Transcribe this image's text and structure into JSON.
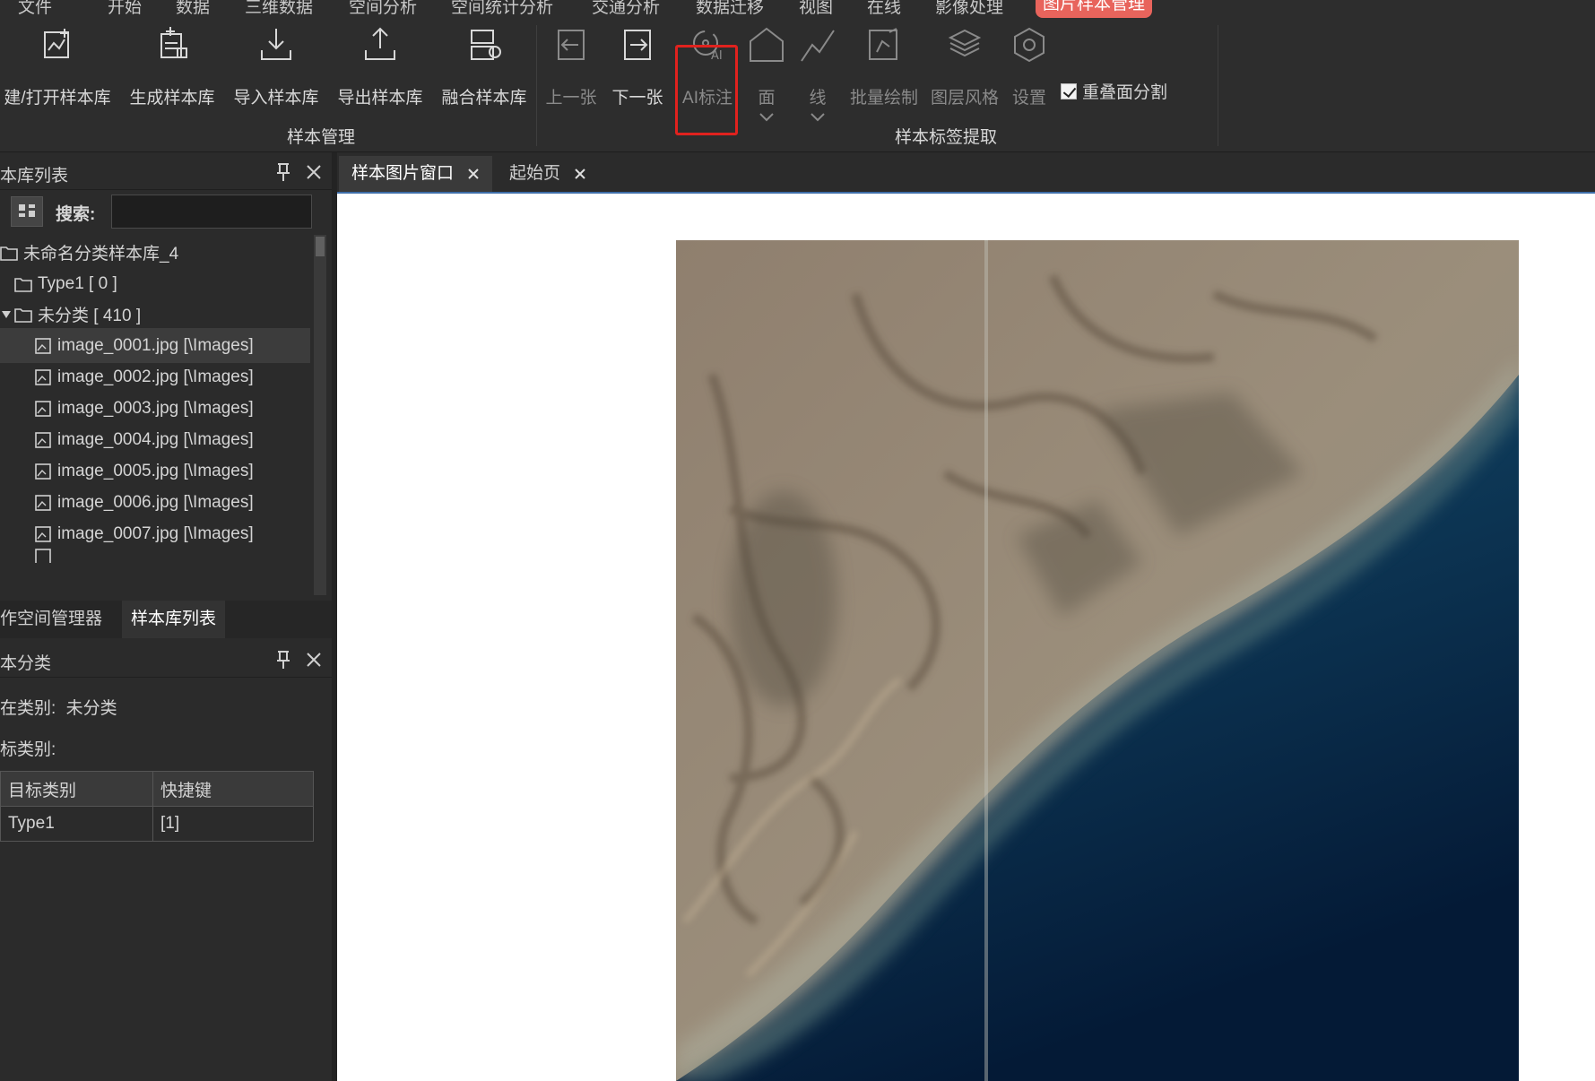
{
  "menu": {
    "items": [
      "文件",
      "开始",
      "数据",
      "三维数据",
      "空间分析",
      "空间统计分析",
      "交通分析",
      "数据迁移",
      "视图",
      "在线",
      "影像处理"
    ],
    "active": "图片样本管理"
  },
  "ribbon": {
    "sample_management": {
      "group_label": "样本管理",
      "buttons": [
        "建/打开样本库",
        "生成样本库",
        "导入样本库",
        "导出样本库",
        "融合样本库"
      ]
    },
    "label_extraction": {
      "group_label": "样本标签提取",
      "prev": "上一张",
      "next": "下一张",
      "ai_label": "AI标注",
      "polygon": "面",
      "line": "线",
      "batch_draw": "批量绘制",
      "layer_style": "图层风格",
      "settings": "设置",
      "overlap_split": "重叠面分割",
      "overlap_checked": true
    }
  },
  "library_panel": {
    "title": "本库列表",
    "search_label": "搜索:",
    "search_value": "",
    "root": "未命名分类样本库_4",
    "type1": "Type1 [ 0 ]",
    "unclassified": "未分类 [ 410 ]",
    "files": [
      "image_0001.jpg [\\Images]",
      "image_0002.jpg [\\Images]",
      "image_0003.jpg [\\Images]",
      "image_0004.jpg [\\Images]",
      "image_0005.jpg [\\Images]",
      "image_0006.jpg [\\Images]",
      "image_0007.jpg [\\Images]"
    ]
  },
  "bottom_tabs": [
    "作空间管理器",
    "样本库列表"
  ],
  "class_panel": {
    "title": "本分类",
    "current_label": "在类别:",
    "current_value": "未分类",
    "target_label": "标类别:",
    "columns": [
      "目标类别",
      "快捷键"
    ],
    "rows": [
      [
        "Type1",
        "[1]"
      ]
    ]
  },
  "doc_tabs": [
    "样本图片窗口",
    "起始页"
  ],
  "colors": {
    "accent_tab": "#e8645c",
    "highlight_box": "#e0221e",
    "panel_bg": "#2b2b2b"
  }
}
